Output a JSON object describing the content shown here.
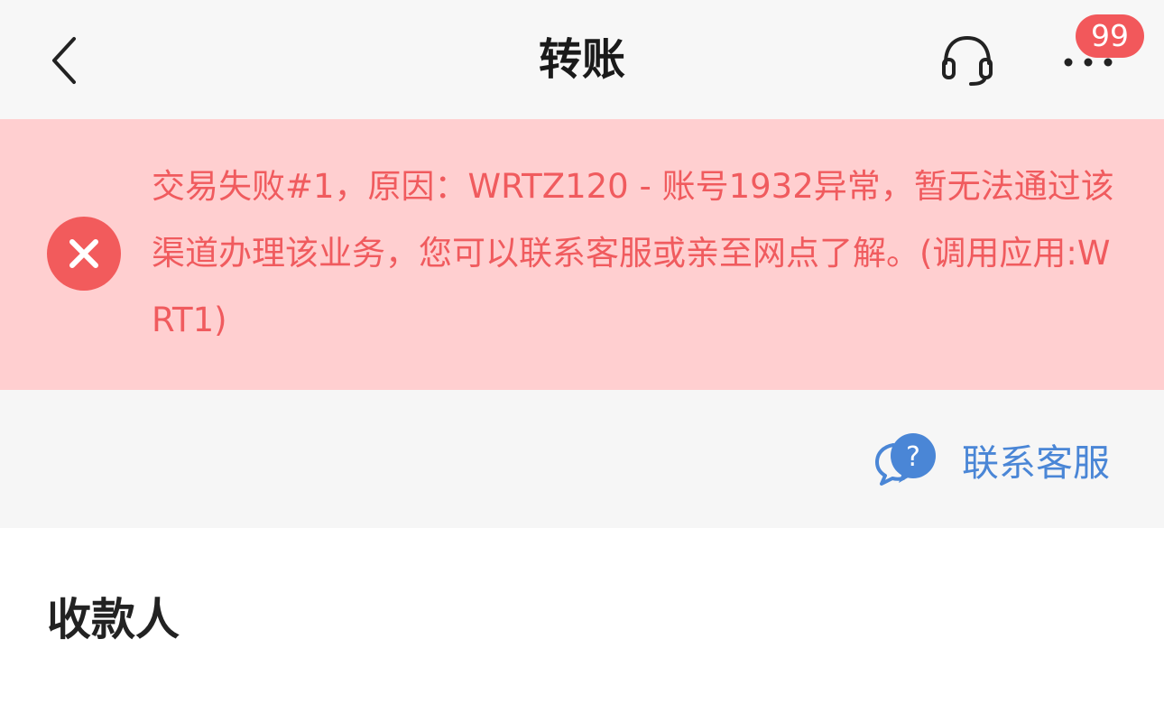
{
  "colors": {
    "nav_background": "#f7f7f7",
    "error_banner_background": "#ffcfd0",
    "error_text": "#f05b5e",
    "error_icon": "#f25b5c",
    "badge_background": "#f2585b",
    "link_blue": "#4a86d6",
    "contact_area_background": "#f6f6f6"
  },
  "navbar": {
    "title": "转账",
    "back_icon": "chevron-left-icon",
    "support_icon": "headset-icon",
    "more_icon": "more-dots-icon",
    "badge_count": "99"
  },
  "error_banner": {
    "icon": "close-circle-icon",
    "message": "交易失败#1，原因：WRTZ120 - 账号1932异常，暂无法通过该渠道办理该业务，您可以联系客服或亲至网点了解。(调用应用:WRT1)"
  },
  "contact": {
    "icon": "chat-question-icon",
    "label": "联系客服"
  },
  "payee_section": {
    "title": "收款人"
  }
}
